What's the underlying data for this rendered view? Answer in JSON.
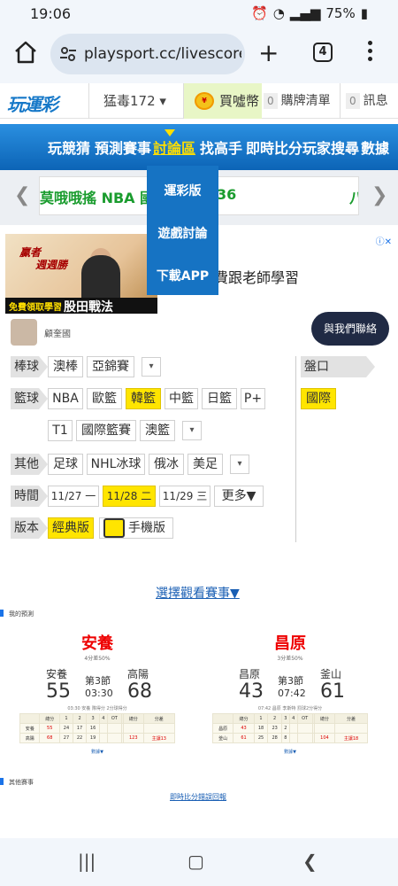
{
  "status": {
    "time": "19:06",
    "battery": "75%"
  },
  "browser": {
    "url": "playsport.cc/livescore.p",
    "tab_count": "4"
  },
  "site": {
    "logo": "玩運彩",
    "user": "猛毒172 ▾",
    "coin_label": "買噓幣",
    "cart": {
      "count": "0",
      "label": "購牌清單"
    },
    "msg": {
      "count": "0",
      "label": "訊息"
    }
  },
  "nav": {
    "items": [
      "玩競猜",
      "預測賽事",
      "討論區",
      "找高手",
      "即時比分",
      "玩家搜尋",
      "數據"
    ],
    "active": "討論區"
  },
  "dropdown": {
    "items": [
      "運彩版",
      "遊戲討論",
      "下載APP"
    ]
  },
  "ticker": {
    "text1": "莫哦哦搖 NBA 國際盤",
    "text2": "36",
    "text3": "八"
  },
  "ad": {
    "img_line1": "贏者",
    "img_line2": "週週勝",
    "img_strip1": "免費領取學習",
    "img_strip2": "股田戰法",
    "headline": "免費跟老師學習",
    "name": "顧奎國",
    "contact": "與我們聯絡"
  },
  "filters": {
    "baseball": {
      "label": "棒球",
      "chips": [
        "澳棒",
        "亞錦賽"
      ]
    },
    "basketball": {
      "label": "籃球",
      "chips": [
        "NBA",
        "歐籃",
        "韓籃",
        "中籃",
        "日籃",
        "P+"
      ],
      "chips_row2": [
        "T1",
        "國際籃賽",
        "澳籃"
      ],
      "selected": "韓籃"
    },
    "other": {
      "label": "其他",
      "chips": [
        "足球",
        "NHL冰球",
        "俄冰",
        "美足"
      ]
    },
    "time": {
      "label": "時間",
      "d1": "11/27 一",
      "d2": "11/28 二",
      "d3": "11/29 三",
      "more": "更多▼"
    },
    "version": {
      "label": "版本",
      "classic": "經典版",
      "mobile": "手機版"
    },
    "odds": {
      "label": "盤口",
      "value": "國際"
    }
  },
  "select_games": "選擇觀看賽事▼",
  "prediction": {
    "title": "我的預測",
    "cards": [
      {
        "pick": "安養",
        "pct": "4分差50%",
        "home": "安養",
        "away": "高陽",
        "home_score": "55",
        "away_score": "68",
        "period": "第3節",
        "clock": "03:30",
        "note": "03:30 安養 隊得分 2分球得分",
        "header": [
          "",
          "總分",
          "1",
          "2",
          "3",
          "4",
          "OT",
          "",
          "總分",
          "分差"
        ],
        "rows": [
          [
            "安養",
            "55",
            "24",
            "17",
            "16",
            "",
            "",
            "",
            "",
            ""
          ],
          [
            "高陽",
            "68",
            "27",
            "22",
            "19",
            "",
            "",
            "",
            "123",
            "主讓13"
          ]
        ],
        "detail": "數據▼"
      },
      {
        "pick": "昌原",
        "pct": "3分差50%",
        "home": "昌原",
        "away": "釜山",
        "home_score": "43",
        "away_score": "61",
        "period": "第3節",
        "clock": "07:42",
        "note": "07:42 昌原 李斯特 罰球2分得分",
        "header": [
          "",
          "總分",
          "1",
          "2",
          "3",
          "4",
          "OT",
          "",
          "總分",
          "分差"
        ],
        "rows": [
          [
            "昌原",
            "43",
            "18",
            "23",
            "2",
            "",
            "",
            "",
            "",
            ""
          ],
          [
            "釜山",
            "61",
            "25",
            "28",
            "8",
            "",
            "",
            "",
            "104",
            "主讓18"
          ]
        ],
        "detail": "數據▼"
      }
    ]
  },
  "other_title": "其他賽事",
  "other_link": "即時比分錯誤回報"
}
